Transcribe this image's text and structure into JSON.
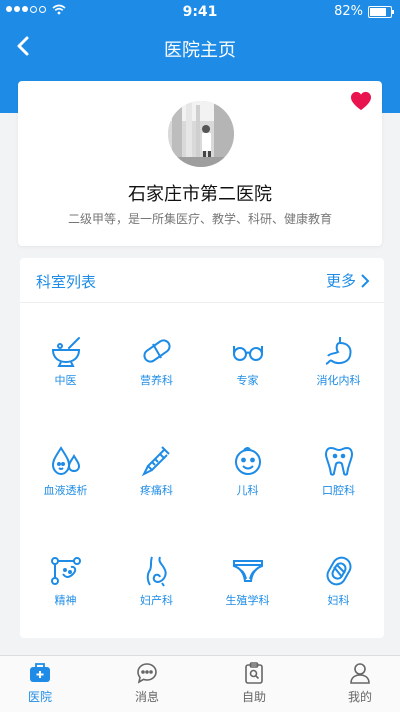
{
  "status": {
    "time": "9:41",
    "battery": "82%"
  },
  "nav": {
    "title": "医院主页"
  },
  "hospital": {
    "name": "石家庄市第二医院",
    "description": "二级甲等，是一所集医疗、教学、科研、健康教育"
  },
  "departments": {
    "title": "科室列表",
    "more": "更多",
    "items": [
      {
        "label": "中医",
        "icon": "mortar-pestle-icon"
      },
      {
        "label": "营养科",
        "icon": "capsule-icon"
      },
      {
        "label": "专家",
        "icon": "glasses-icon"
      },
      {
        "label": "消化内科",
        "icon": "stomach-icon"
      },
      {
        "label": "血液透析",
        "icon": "blood-drops-icon"
      },
      {
        "label": "疼痛科",
        "icon": "syringe-icon"
      },
      {
        "label": "儿科",
        "icon": "baby-face-icon"
      },
      {
        "label": "口腔科",
        "icon": "tooth-icon"
      },
      {
        "label": "精神",
        "icon": "brain-network-icon"
      },
      {
        "label": "妇产科",
        "icon": "pregnancy-icon"
      },
      {
        "label": "生殖学科",
        "icon": "underwear-icon"
      },
      {
        "label": "妇科",
        "icon": "pad-icon"
      }
    ]
  },
  "tabs": [
    {
      "label": "医院",
      "icon": "hospital-kit-icon"
    },
    {
      "label": "消息",
      "icon": "chat-icon"
    },
    {
      "label": "自助",
      "icon": "clipboard-icon"
    },
    {
      "label": "我的",
      "icon": "person-icon"
    }
  ],
  "colors": {
    "primary": "#1e8ce6",
    "heart": "#e8134f",
    "background": "#f2f3f5"
  }
}
